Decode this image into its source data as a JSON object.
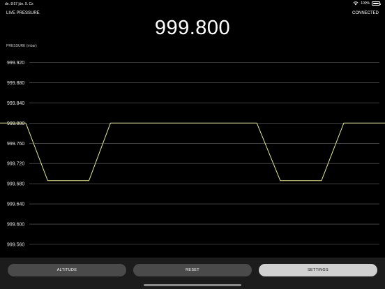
{
  "status_bar": {
    "time": "de. 8:57   jún. 9. Cs",
    "battery": "100%",
    "icons": [
      "wifi-icon",
      "battery-icon"
    ]
  },
  "header": {
    "left_label": "LIVE PRESSURE",
    "right_label": "CONNECTED",
    "value": "999.800"
  },
  "buttons": {
    "altitude": "ALTITUDE",
    "reset": "RESET",
    "settings": "SETTINGS"
  },
  "colors": {
    "background": "#000000",
    "line": "#e8e89a",
    "grid": "#6a6a6a",
    "button_dark": "#4a4a4a",
    "button_light": "#d0d0d0",
    "bottom_bar": "#1c1c1c"
  },
  "chart_data": {
    "type": "line",
    "ylabel": "PRESSURE (mbar)",
    "ylim": [
      999.52,
      999.94
    ],
    "y_ticks": [
      "999.920",
      "999.880",
      "999.840",
      "999.800",
      "999.760",
      "999.720",
      "999.680",
      "999.640",
      "999.600",
      "999.560"
    ],
    "grid": true,
    "x_range": [
      0,
      100
    ],
    "series": [
      {
        "x": [
          0,
          6.7,
          12.4,
          23.1,
          28.7,
          66.7,
          72.8,
          83.5,
          89.3,
          100
        ],
        "y": [
          999.8,
          999.8,
          999.686,
          999.686,
          999.8,
          999.8,
          999.686,
          999.686,
          999.8,
          999.8
        ]
      }
    ]
  }
}
